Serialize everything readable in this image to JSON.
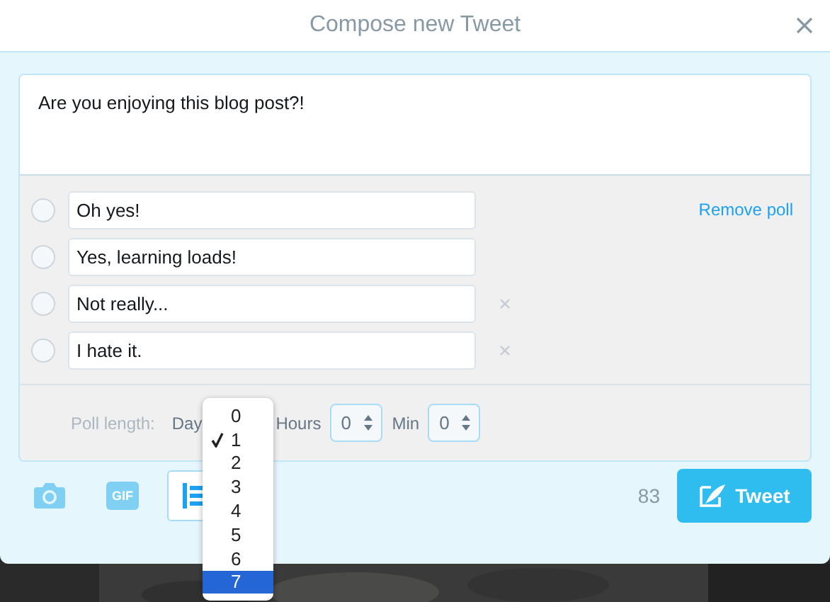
{
  "window": {
    "title": "Compose new Tweet"
  },
  "tweet": {
    "value": "Are you enjoying this blog post?!"
  },
  "poll": {
    "remove_label": "Remove poll",
    "options": [
      {
        "value": "Oh yes!",
        "selected": false,
        "removable": false
      },
      {
        "value": "Yes, learning loads!",
        "selected": false,
        "removable": false
      },
      {
        "value": "Not really...",
        "selected": false,
        "removable": true
      },
      {
        "value": "I hate it.",
        "selected": false,
        "removable": true
      }
    ],
    "length_label": "Poll length:",
    "days_label": "Day",
    "hours_label": "Hours",
    "hours_value": "0",
    "min_label": "Min",
    "min_value": "0",
    "days_menu": [
      {
        "label": "0",
        "checked": false,
        "selected": false
      },
      {
        "label": "1",
        "checked": true,
        "selected": false
      },
      {
        "label": "2",
        "checked": false,
        "selected": false
      },
      {
        "label": "3",
        "checked": false,
        "selected": false
      },
      {
        "label": "4",
        "checked": false,
        "selected": false
      },
      {
        "label": "5",
        "checked": false,
        "selected": false
      },
      {
        "label": "6",
        "checked": false,
        "selected": false
      },
      {
        "label": "7",
        "checked": false,
        "selected": true
      }
    ]
  },
  "toolbar": {
    "gif_label": "GIF",
    "counter": "83",
    "tweet_button": "Tweet"
  }
}
